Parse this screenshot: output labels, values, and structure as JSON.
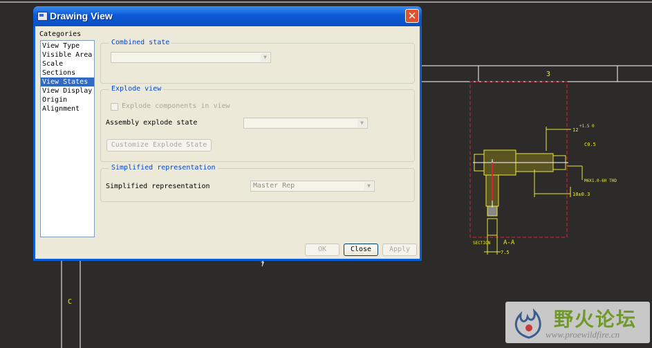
{
  "dialog": {
    "title": "Drawing View",
    "close_glyph": "✕",
    "categories_label": "Categories",
    "categories": [
      {
        "label": "View Type",
        "selected": false
      },
      {
        "label": "Visible Area",
        "selected": false
      },
      {
        "label": "Scale",
        "selected": false
      },
      {
        "label": "Sections",
        "selected": false
      },
      {
        "label": "View States",
        "selected": true
      },
      {
        "label": "View Display",
        "selected": false
      },
      {
        "label": "Origin",
        "selected": false
      },
      {
        "label": "Alignment",
        "selected": false
      }
    ],
    "combined_state": {
      "legend": "Combined state",
      "value": ""
    },
    "explode_view": {
      "legend": "Explode view",
      "checkbox_label": "Explode components in view",
      "assembly_label": "Assembly explode state",
      "assembly_value": "",
      "customize_button": "Customize Explode State"
    },
    "simplified": {
      "legend": "Simplified representation",
      "label": "Simplified representation",
      "value": "Master Rep"
    },
    "buttons": {
      "ok": "OK",
      "close": "Close",
      "apply": "Apply"
    }
  },
  "drawing": {
    "zone_3": "3",
    "zone_c": "C",
    "zone_7": "7",
    "dim_top": "12",
    "dim_tol": "+1.5\n 0",
    "chamfer": "C0.5",
    "thread": "M6X1.0-6H THD",
    "dim_length": "18±0.3",
    "section_word": "SECTION",
    "section_id": "A-A",
    "dim_bottom": "7.5"
  },
  "watermark": {
    "chinese": "野火论坛",
    "url": "www.proewildfire.cn"
  },
  "colors": {
    "selection": "#316ac5",
    "legend_blue": "#0046d5",
    "drawing_yellow": "#e8e83a",
    "drawing_red": "#e0203a"
  },
  "icons": [
    "dialog-app-icon",
    "close-icon",
    "chevron-down-icon",
    "flame-logo-icon"
  ]
}
